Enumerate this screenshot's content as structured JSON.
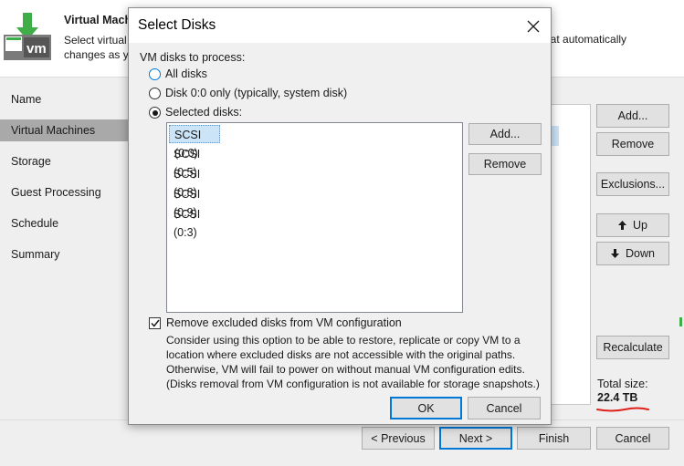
{
  "wizard": {
    "title": "Virtual Machi",
    "description": "Select virtual",
    "description_line2": "changes as yo",
    "description_tail": "hat automatically",
    "nav": [
      "Name",
      "Virtual Machines",
      "Storage",
      "Guest Processing",
      "Schedule",
      "Summary"
    ],
    "active_nav": "Virtual Machines",
    "side_buttons": {
      "add": "Add...",
      "remove": "Remove",
      "exclusions": "Exclusions...",
      "up": "Up",
      "down": "Down",
      "recalculate": "Recalculate"
    },
    "total_size_label": "Total size:",
    "total_size_value": "22.4 TB",
    "footer": {
      "previous": "< Previous",
      "next": "Next >",
      "finish": "Finish",
      "cancel": "Cancel"
    }
  },
  "dialog": {
    "title": "Select Disks",
    "process_label": "VM disks to process:",
    "options": [
      {
        "label": "All disks",
        "checked": false
      },
      {
        "label": "Disk 0:0 only (typically, system disk)",
        "checked": false
      },
      {
        "label": "Selected disks:",
        "checked": true
      }
    ],
    "disks": [
      "SCSI (0:0)",
      "SCSI (0:5)",
      "SCSI (0:8)",
      "SCSI (0:9)",
      "SCSI (0:3)"
    ],
    "selected_disk": "SCSI (0:0)",
    "add_button": "Add...",
    "remove_button": "Remove",
    "remove_excluded_label": "Remove excluded disks from VM configuration",
    "remove_excluded_checked": true,
    "note": [
      "Consider using this option to be able to restore, replicate or copy VM to a",
      "location where excluded disks are not accessible with the original paths.",
      "Otherwise, VM will fail to power on without manual VM configuration edits.",
      "(Disks removal from VM configuration is not available for storage snapshots.)"
    ],
    "ok_button": "OK",
    "cancel_button": "Cancel"
  },
  "colors": {
    "accent": "#0078d7",
    "selection": "#cce4f7",
    "brand_green": "#3fae49",
    "annotation_red": "#e0201a"
  },
  "icons": [
    "vm-logo-icon",
    "arrow-up-icon",
    "arrow-down-icon",
    "close-icon",
    "checkmark-icon"
  ]
}
